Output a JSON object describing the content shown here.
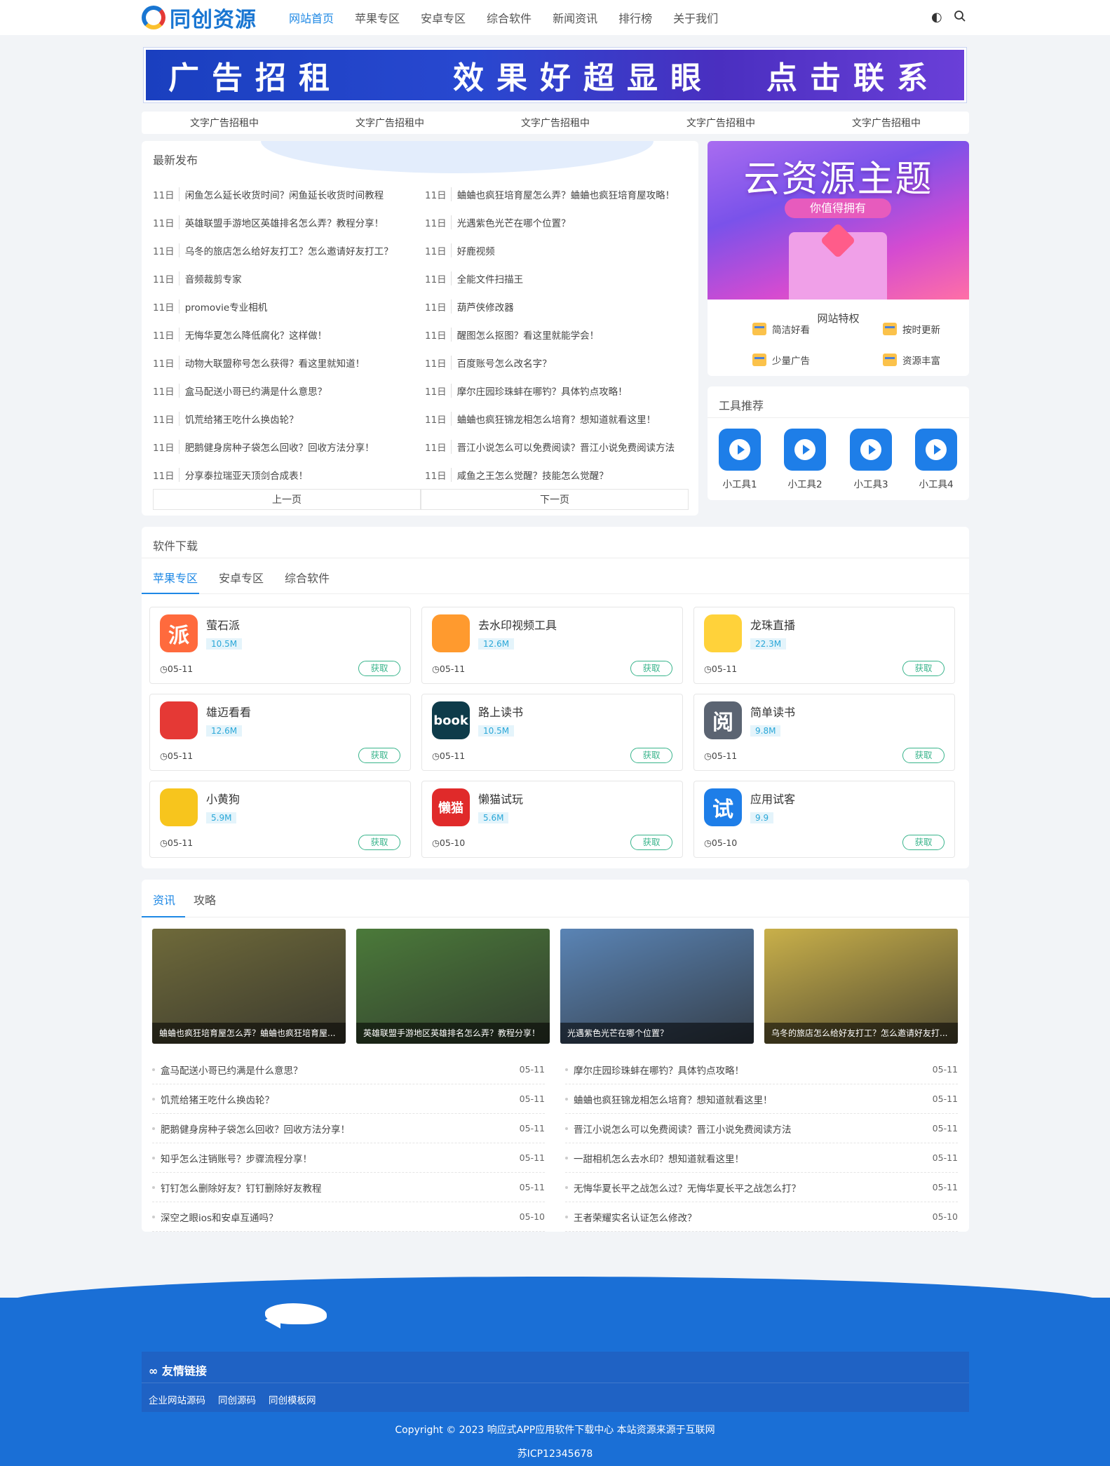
{
  "header": {
    "logo_text": "同创资源",
    "nav": [
      "网站首页",
      "苹果专区",
      "安卓专区",
      "综合软件",
      "新闻资讯",
      "排行榜",
      "关于我们"
    ],
    "theme_icon": "contrast-icon",
    "search_icon": "search-icon"
  },
  "banner": {
    "part1": "广告招租",
    "part2": "效果好超显眼",
    "part3": "点击联系"
  },
  "text_ads": [
    "文字广告招租中",
    "文字广告招租中",
    "文字广告招租中",
    "文字广告招租中",
    "文字广告招租中"
  ],
  "latest": {
    "title": "最新发布",
    "items": [
      {
        "date": "11日",
        "title": "闲鱼怎么延长收货时间？闲鱼延长收货时间教程"
      },
      {
        "date": "11日",
        "title": "蛐蛐也疯狂培育屋怎么弄？蛐蛐也疯狂培育屋攻略！"
      },
      {
        "date": "11日",
        "title": "英雄联盟手游地区英雄排名怎么弄？教程分享！"
      },
      {
        "date": "11日",
        "title": "光遇紫色光芒在哪个位置？"
      },
      {
        "date": "11日",
        "title": "乌冬的旅店怎么给好友打工？怎么邀请好友打工？"
      },
      {
        "date": "11日",
        "title": "好鹿视频"
      },
      {
        "date": "11日",
        "title": "音频裁剪专家"
      },
      {
        "date": "11日",
        "title": "全能文件扫描王"
      },
      {
        "date": "11日",
        "title": "promovie专业相机"
      },
      {
        "date": "11日",
        "title": "葫芦侠修改器"
      },
      {
        "date": "11日",
        "title": "无悔华夏怎么降低腐化？这样做！"
      },
      {
        "date": "11日",
        "title": "醒图怎么抠图？看这里就能学会！"
      },
      {
        "date": "11日",
        "title": "动物大联盟称号怎么获得？看这里就知道！"
      },
      {
        "date": "11日",
        "title": "百度账号怎么改名字？"
      },
      {
        "date": "11日",
        "title": "盒马配送小哥已约满是什么意思？"
      },
      {
        "date": "11日",
        "title": "摩尔庄园珍珠蚌在哪钓？具体钓点攻略！"
      },
      {
        "date": "11日",
        "title": "饥荒给猪王吃什么换齿轮？"
      },
      {
        "date": "11日",
        "title": "蛐蛐也疯狂锦龙相怎么培育？想知道就看这里！"
      },
      {
        "date": "11日",
        "title": "肥鹅健身房种子袋怎么回收？回收方法分享！"
      },
      {
        "date": "11日",
        "title": "晋江小说怎么可以免费阅读？晋江小说免费阅读方法"
      },
      {
        "date": "11日",
        "title": "分享泰拉瑞亚天顶剑合成表！"
      },
      {
        "date": "11日",
        "title": "咸鱼之王怎么觉醒？技能怎么觉醒？"
      }
    ],
    "prev": "上一页",
    "next": "下一页"
  },
  "promo": {
    "title": "云资源主题",
    "subtitle": "你值得拥有",
    "features_title": "网站特权",
    "features": [
      "简洁好看",
      "按时更新",
      "少量广告",
      "资源丰富"
    ]
  },
  "tools": {
    "title": "工具推荐",
    "items": [
      "小工具1",
      "小工具2",
      "小工具3",
      "小工具4"
    ]
  },
  "software": {
    "title": "软件下载",
    "tabs": [
      "苹果专区",
      "安卓专区",
      "综合软件"
    ],
    "get_label": "获取",
    "apps": [
      {
        "name": "萤石派",
        "size": "10.5M",
        "date": "05-11",
        "icon_text": "派",
        "color": "#ff6a3d"
      },
      {
        "name": "去水印视频工具",
        "size": "12.6M",
        "date": "05-11",
        "icon_text": "",
        "color": "#ff9a2e"
      },
      {
        "name": "龙珠直播",
        "size": "22.3M",
        "date": "05-11",
        "icon_text": "",
        "color": "#ffd23a"
      },
      {
        "name": "雄迈看看",
        "size": "12.6M",
        "date": "05-11",
        "icon_text": "",
        "color": "#e53935"
      },
      {
        "name": "路上读书",
        "size": "10.5M",
        "date": "05-11",
        "icon_text": "book",
        "color": "#0e3b4a"
      },
      {
        "name": "简单读书",
        "size": "9.8M",
        "date": "05-11",
        "icon_text": "阅",
        "color": "#5b6472"
      },
      {
        "name": "小黄狗",
        "size": "5.9M",
        "date": "05-11",
        "icon_text": "",
        "color": "#f7c51d"
      },
      {
        "name": "懒猫试玩",
        "size": "5.6M",
        "date": "05-10",
        "icon_text": "懒猫",
        "color": "#e02a2a"
      },
      {
        "name": "应用试客",
        "size": "9.9",
        "date": "05-10",
        "icon_text": "试",
        "color": "#1e7ee8"
      }
    ]
  },
  "news": {
    "tabs": [
      "资讯",
      "攻略"
    ],
    "thumbs": [
      {
        "caption": "蛐蛐也疯狂培育屋怎么弄？蛐蛐也疯狂培育屋...",
        "color": "#6f6a3a"
      },
      {
        "caption": "英雄联盟手游地区英雄排名怎么弄？教程分享！",
        "color": "#4b7a3a"
      },
      {
        "caption": "光遇紫色光芒在哪个位置？",
        "color": "#5a84b5"
      },
      {
        "caption": "乌冬的旅店怎么给好友打工？怎么邀请好友打...",
        "color": "#c9b04a"
      }
    ],
    "left": [
      {
        "title": "盒马配送小哥已约满是什么意思？",
        "date": "05-11"
      },
      {
        "title": "饥荒给猪王吃什么换齿轮？",
        "date": "05-11"
      },
      {
        "title": "肥鹅健身房种子袋怎么回收？回收方法分享！",
        "date": "05-11"
      },
      {
        "title": "知乎怎么注销账号？步骤流程分享！",
        "date": "05-11"
      },
      {
        "title": "钉钉怎么删除好友？钉钉删除好友教程",
        "date": "05-11"
      },
      {
        "title": "深空之眼ios和安卓互通吗？",
        "date": "05-10"
      }
    ],
    "right": [
      {
        "title": "摩尔庄园珍珠蚌在哪钓？具体钓点攻略！",
        "date": "05-11"
      },
      {
        "title": "蛐蛐也疯狂锦龙相怎么培育？想知道就看这里！",
        "date": "05-11"
      },
      {
        "title": "晋江小说怎么可以免费阅读？晋江小说免费阅读方法",
        "date": "05-11"
      },
      {
        "title": "一甜相机怎么去水印？想知道就看这里！",
        "date": "05-11"
      },
      {
        "title": "无悔华夏长平之战怎么过？无悔华夏长平之战怎么打？",
        "date": "05-11"
      },
      {
        "title": "王者荣耀实名认证怎么修改？",
        "date": "05-10"
      }
    ]
  },
  "footer": {
    "links_title": "友情链接",
    "links": [
      "企业网站源码",
      "同创源码",
      "同创模板网"
    ],
    "copyright": "Copyright © 2023 响应式APP应用软件下载中心 本站资源来源于互联网",
    "icp": "苏ICP12345678"
  }
}
